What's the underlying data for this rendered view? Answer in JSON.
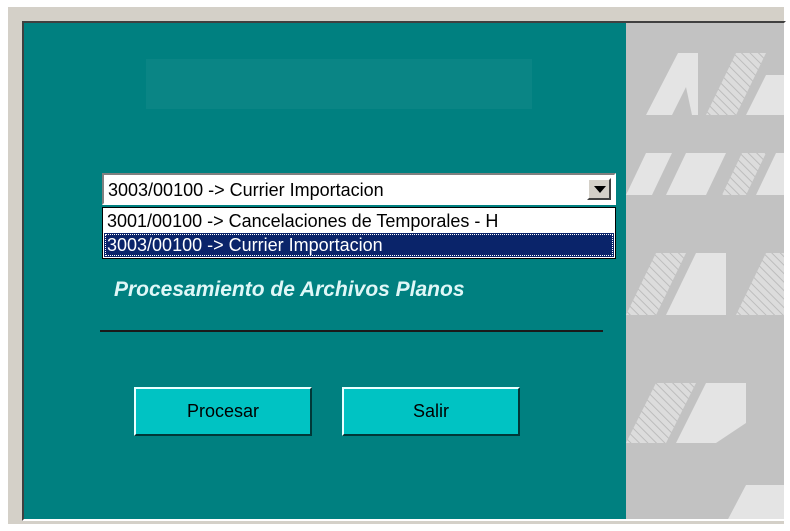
{
  "combo": {
    "selected": "3003/00100 -> Currier Importacion"
  },
  "dropdown": {
    "options": [
      "3001/00100 -> Cancelaciones de Temporales - H",
      "3003/00100 -> Currier Importacion"
    ],
    "highlighted_index": 1
  },
  "form": {
    "title": "Procesamiento de Archivos Planos"
  },
  "buttons": {
    "process_label": "Procesar",
    "exit_label": "Salir"
  },
  "colors": {
    "panel": "#008080",
    "button_face": "#00c3c3",
    "selection": "#0a246a",
    "logo_background": "#c2c2c2"
  }
}
